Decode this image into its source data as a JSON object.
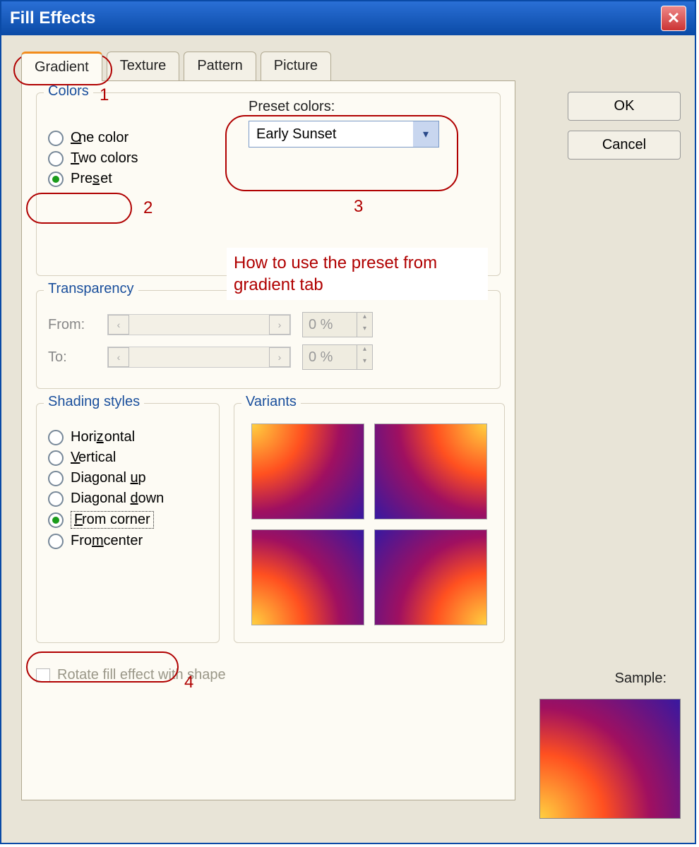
{
  "title": "Fill Effects",
  "tabs": [
    {
      "label": "Gradient",
      "active": true
    },
    {
      "label": "Texture",
      "active": false
    },
    {
      "label": "Pattern",
      "active": false
    },
    {
      "label": "Picture",
      "active": false
    }
  ],
  "buttons": {
    "ok": "OK",
    "cancel": "Cancel"
  },
  "colors": {
    "legend": "Colors",
    "options": [
      {
        "label_pre": "",
        "key": "O",
        "label_post": "ne color",
        "selected": false
      },
      {
        "label_pre": "",
        "key": "T",
        "label_post": "wo colors",
        "selected": false
      },
      {
        "label_pre": "Pre",
        "key": "s",
        "label_post": "et",
        "selected": true
      }
    ],
    "preset_label": "Preset colors:",
    "preset_value": "Early Sunset"
  },
  "transparency": {
    "legend": "Transparency",
    "from_label": "From:",
    "from_value": "0 %",
    "to_label": "To:",
    "to_value": "0 %"
  },
  "shading": {
    "legend": "Shading styles",
    "options": [
      {
        "label_pre": "Hori",
        "key": "z",
        "label_post": "ontal",
        "selected": false
      },
      {
        "label_pre": "",
        "key": "V",
        "label_post": "ertical",
        "selected": false
      },
      {
        "label_pre": "Diagonal ",
        "key": "u",
        "label_post": "p",
        "selected": false
      },
      {
        "label_pre": "Diagonal ",
        "key": "d",
        "label_post": "own",
        "selected": false
      },
      {
        "label_pre": "",
        "key": "F",
        "label_post": "rom corner",
        "selected": true
      },
      {
        "label_pre": "Fro",
        "key": "m",
        "label_post": " center",
        "selected": false
      }
    ]
  },
  "variants_legend": "Variants",
  "sample_label": "Sample:",
  "rotate": {
    "label": "Rotate fill effect with shape",
    "checked": false,
    "enabled": false
  },
  "annotations": {
    "n1": "1",
    "n2": "2",
    "n3": "3",
    "n4": "4",
    "text": "How to use the preset from gradient tab"
  }
}
